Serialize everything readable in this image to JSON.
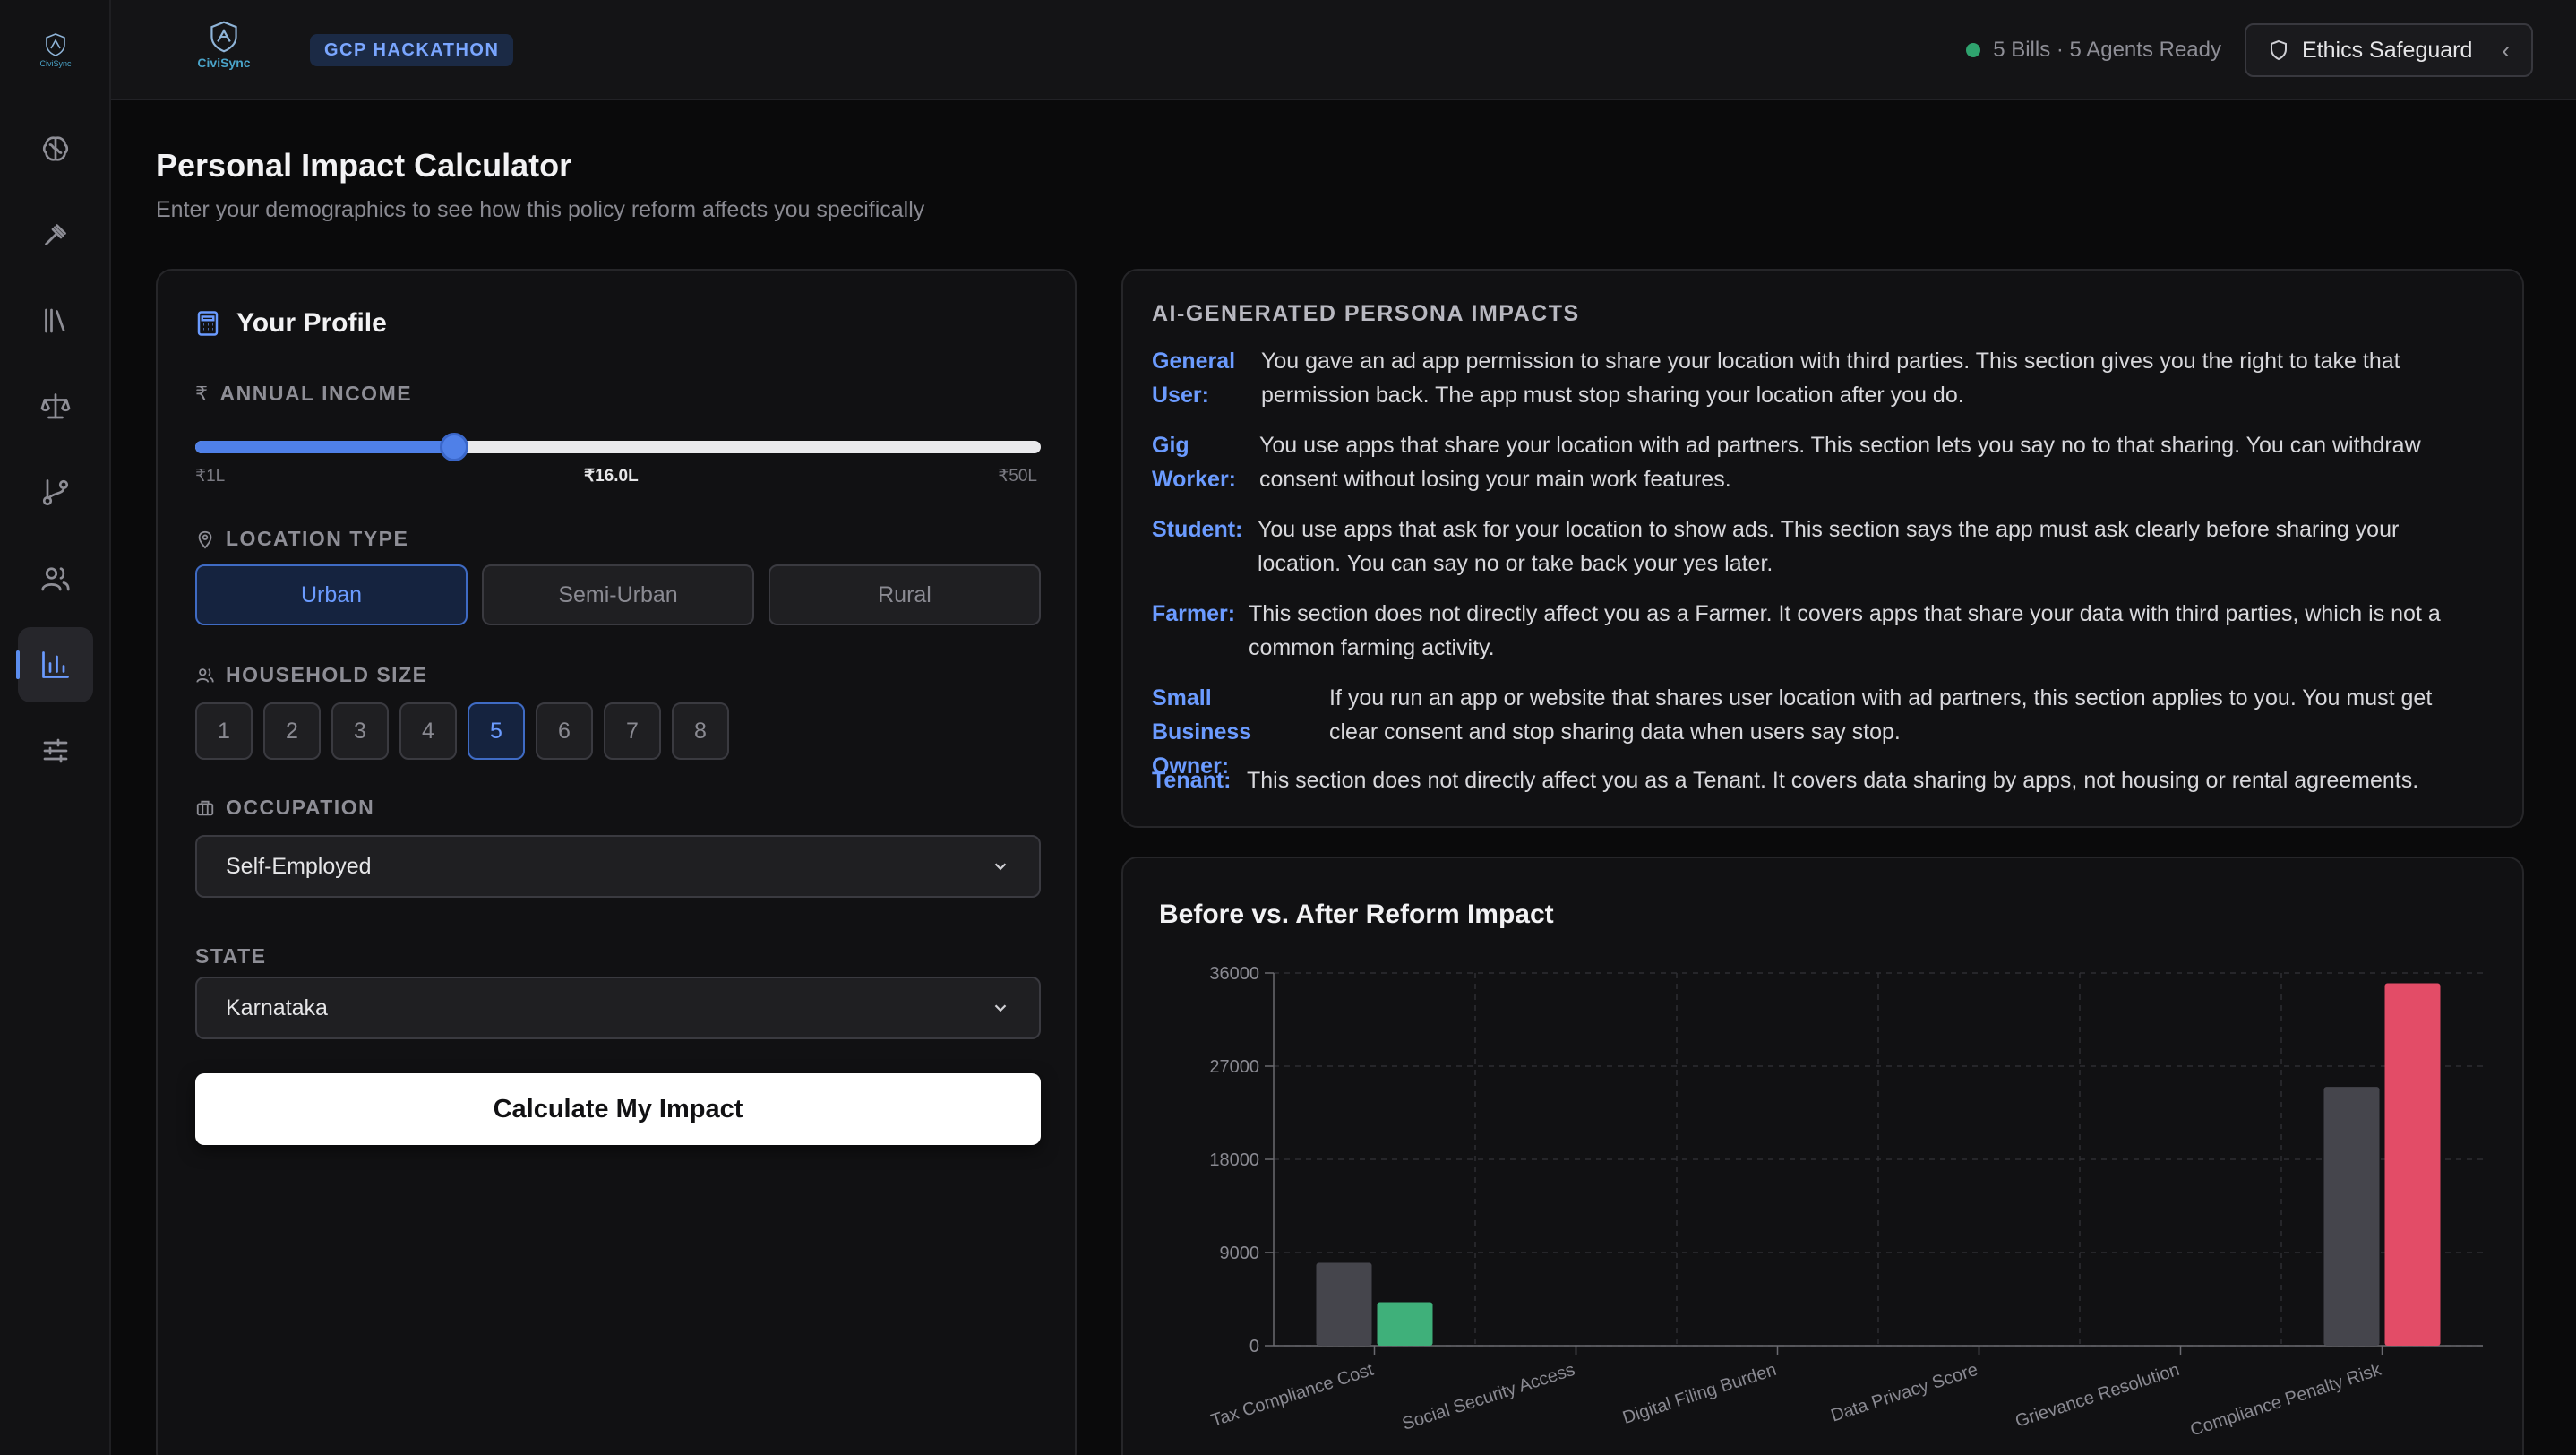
{
  "sidebar": {
    "logo_text": "CiviSync",
    "items": [
      {
        "name": "brain-icon",
        "active": false
      },
      {
        "name": "gavel-icon",
        "active": false
      },
      {
        "name": "library-icon",
        "active": false
      },
      {
        "name": "scale-icon",
        "active": false
      },
      {
        "name": "git-branch-icon",
        "active": false
      },
      {
        "name": "users-icon",
        "active": false
      },
      {
        "name": "bar-chart-icon",
        "active": true
      },
      {
        "name": "sliders-icon",
        "active": false
      }
    ]
  },
  "header": {
    "logo_text": "CiviSync",
    "badge": "GCP HACKATHON",
    "status_text": "5 Bills · 5 Agents Ready",
    "ethics_label": "Ethics Safeguard"
  },
  "page": {
    "title": "Personal Impact Calculator",
    "subtitle": "Enter your demographics to see how this policy reform affects you specifically"
  },
  "profile": {
    "heading": "Your Profile",
    "income": {
      "label": "ANNUAL INCOME",
      "min_label": "₹1L",
      "max_label": "₹50L",
      "value_label": "₹16.0L",
      "value": 16,
      "min": 1,
      "max": 50
    },
    "location": {
      "label": "LOCATION TYPE",
      "options": [
        "Urban",
        "Semi-Urban",
        "Rural"
      ],
      "selected": "Urban"
    },
    "household": {
      "label": "HOUSEHOLD SIZE",
      "options": [
        "1",
        "2",
        "3",
        "4",
        "5",
        "6",
        "7",
        "8"
      ],
      "selected": "5"
    },
    "occupation": {
      "label": "OCCUPATION",
      "value": "Self-Employed"
    },
    "state": {
      "label": "STATE",
      "value": "Karnataka"
    },
    "calculate_label": "Calculate My Impact"
  },
  "persona": {
    "title": "AI-GENERATED PERSONA IMPACTS",
    "rows": [
      {
        "role": "General User:",
        "text": "You gave an ad app permission to share your location with third parties. This section gives you the right to take that permission back. The app must stop sharing your location after you do."
      },
      {
        "role": "Gig Worker:",
        "text": "You use apps that share your location with ad partners. This section lets you say no to that sharing. You can withdraw consent without losing your main work features."
      },
      {
        "role": "Student:",
        "text": "You use apps that ask for your location to show ads. This section says the app must ask clearly before sharing your location. You can say no or take back your yes later."
      },
      {
        "role": "Farmer:",
        "text": "This section does not directly affect you as a Farmer. It covers apps that share your data with third parties, which is not a common farming activity."
      },
      {
        "role": "Small Business Owner:",
        "text": "If you run an app or website that shares user location with ad partners, this section applies to you. You must get clear consent and stop sharing data when users say stop."
      },
      {
        "role": "Tenant:",
        "text": "This section does not directly affect you as a Tenant. It covers data sharing by apps, not housing or rental agreements."
      }
    ]
  },
  "chart_data": {
    "type": "bar",
    "title": "Before vs. After Reform Impact",
    "categories": [
      "Tax Compliance Cost",
      "Social Security Access",
      "Digital Filing Burden",
      "Data Privacy Score",
      "Grievance Resolution",
      "Compliance Penalty Risk"
    ],
    "series": [
      {
        "values": [
          8000,
          0,
          0,
          0,
          0,
          25000
        ],
        "color": "#45454c"
      },
      {
        "values": [
          4200,
          0,
          0,
          0,
          0,
          35000
        ],
        "colors": [
          "#3fb07a",
          "#3fb07a",
          "#3fb07a",
          "#3fb07a",
          "#3fb07a",
          "#e34c67"
        ]
      }
    ],
    "y_ticks": [
      "0",
      "9000",
      "18000",
      "27000",
      "36000"
    ],
    "ylim": [
      0,
      36000
    ],
    "grid": true
  }
}
